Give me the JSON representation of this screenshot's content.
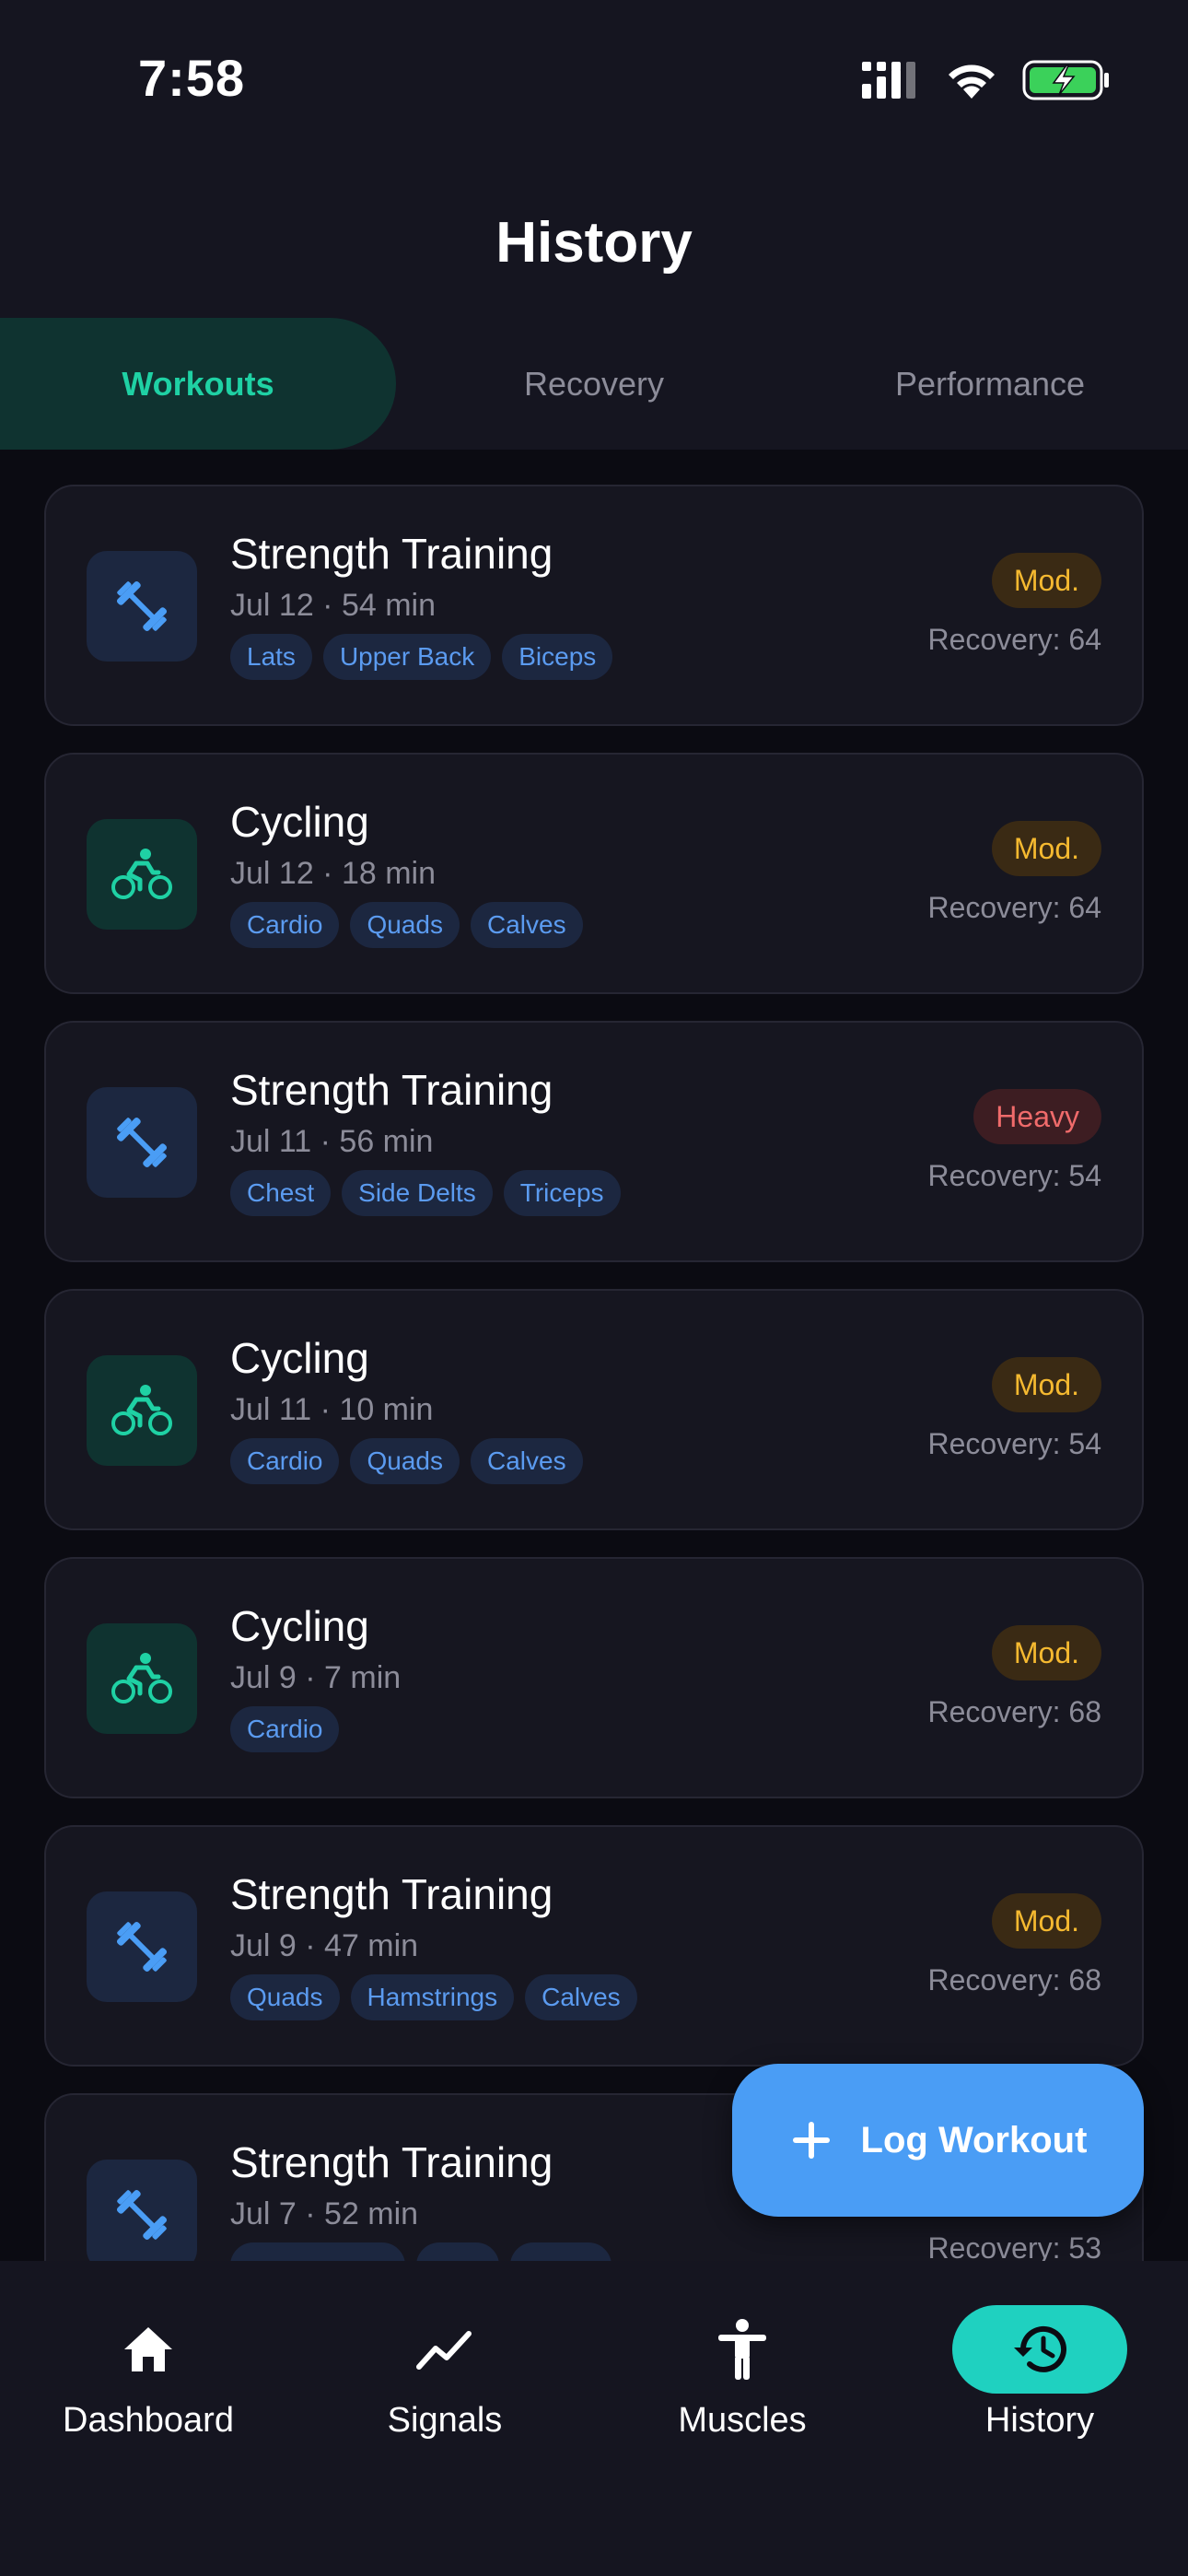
{
  "status_bar": {
    "time": "7:58"
  },
  "header": {
    "title": "History"
  },
  "tabs": [
    {
      "label": "Workouts",
      "active": true
    },
    {
      "label": "Recovery",
      "active": false
    },
    {
      "label": "Performance",
      "active": false
    }
  ],
  "workouts": [
    {
      "type": "strength",
      "icon": "dumbbell-icon",
      "title": "Strength Training",
      "meta": "Jul 12 · 54 min",
      "tags": [
        "Lats",
        "Upper Back",
        "Biceps"
      ],
      "intensity": "Mod.",
      "intensity_level": "mod",
      "recovery": "Recovery: 64"
    },
    {
      "type": "cycling",
      "icon": "bike-icon",
      "title": "Cycling",
      "meta": "Jul 12 · 18 min",
      "tags": [
        "Cardio",
        "Quads",
        "Calves"
      ],
      "intensity": "Mod.",
      "intensity_level": "mod",
      "recovery": "Recovery: 64"
    },
    {
      "type": "strength",
      "icon": "dumbbell-icon",
      "title": "Strength Training",
      "meta": "Jul 11 · 56 min",
      "tags": [
        "Chest",
        "Side Delts",
        "Triceps"
      ],
      "intensity": "Heavy",
      "intensity_level": "heavy",
      "recovery": "Recovery: 54"
    },
    {
      "type": "cycling",
      "icon": "bike-icon",
      "title": "Cycling",
      "meta": "Jul 11 · 10 min",
      "tags": [
        "Cardio",
        "Quads",
        "Calves"
      ],
      "intensity": "Mod.",
      "intensity_level": "mod",
      "recovery": "Recovery: 54"
    },
    {
      "type": "cycling",
      "icon": "bike-icon",
      "title": "Cycling",
      "meta": "Jul 9 · 7 min",
      "tags": [
        "Cardio"
      ],
      "intensity": "Mod.",
      "intensity_level": "mod",
      "recovery": "Recovery: 68"
    },
    {
      "type": "strength",
      "icon": "dumbbell-icon",
      "title": "Strength Training",
      "meta": "Jul 9 · 47 min",
      "tags": [
        "Quads",
        "Hamstrings",
        "Calves"
      ],
      "intensity": "Mod.",
      "intensity_level": "mod",
      "recovery": "Recovery: 68"
    },
    {
      "type": "strength",
      "icon": "dumbbell-icon",
      "title": "Strength Training",
      "meta": "Jul 7 · 52 min",
      "tags": [],
      "intensity": "",
      "intensity_level": "",
      "recovery": "Recovery: 53"
    }
  ],
  "fab": {
    "label": "Log Workout",
    "icon": "plus-icon"
  },
  "bottom_nav": [
    {
      "label": "Dashboard",
      "icon": "home-icon",
      "active": false
    },
    {
      "label": "Signals",
      "icon": "trend-line-icon",
      "active": false
    },
    {
      "label": "Muscles",
      "icon": "body-icon",
      "active": false
    },
    {
      "label": "History",
      "icon": "history-icon",
      "active": true
    }
  ],
  "colors": {
    "accent_teal": "#1fd1a4",
    "fab_blue": "#4a9df5",
    "moderate": "#f5b930",
    "heavy": "#f06b6b",
    "tag_blue": "#5b9bf0"
  }
}
